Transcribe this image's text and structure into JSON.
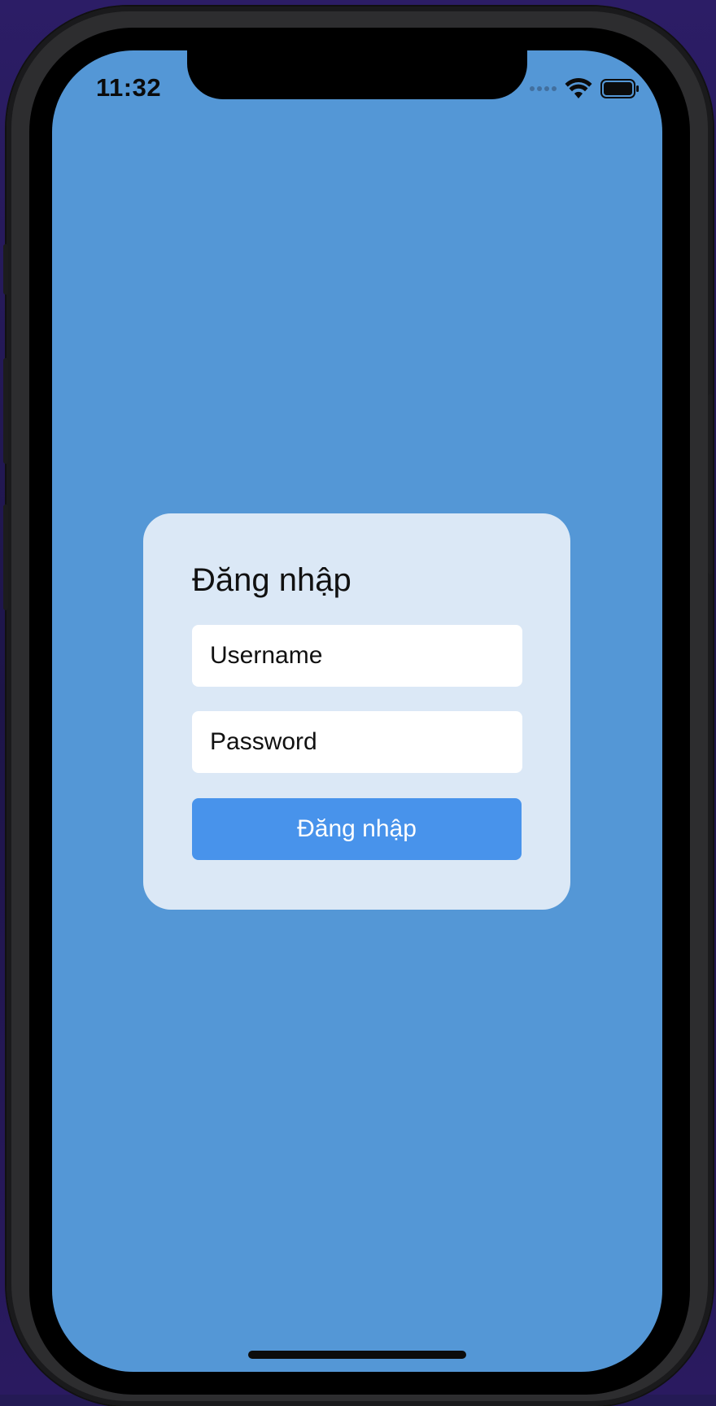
{
  "status_bar": {
    "time": "11:32",
    "wifi_icon": "wifi-icon",
    "battery_icon": "battery-full-icon"
  },
  "login_card": {
    "title": "Đăng nhập",
    "username_placeholder": "Username",
    "password_placeholder": "Password",
    "submit_label": "Đăng nhập"
  },
  "colors": {
    "screen_background": "#5497d6",
    "card_background": "#dbe8f6",
    "button_background": "#4893eb"
  }
}
